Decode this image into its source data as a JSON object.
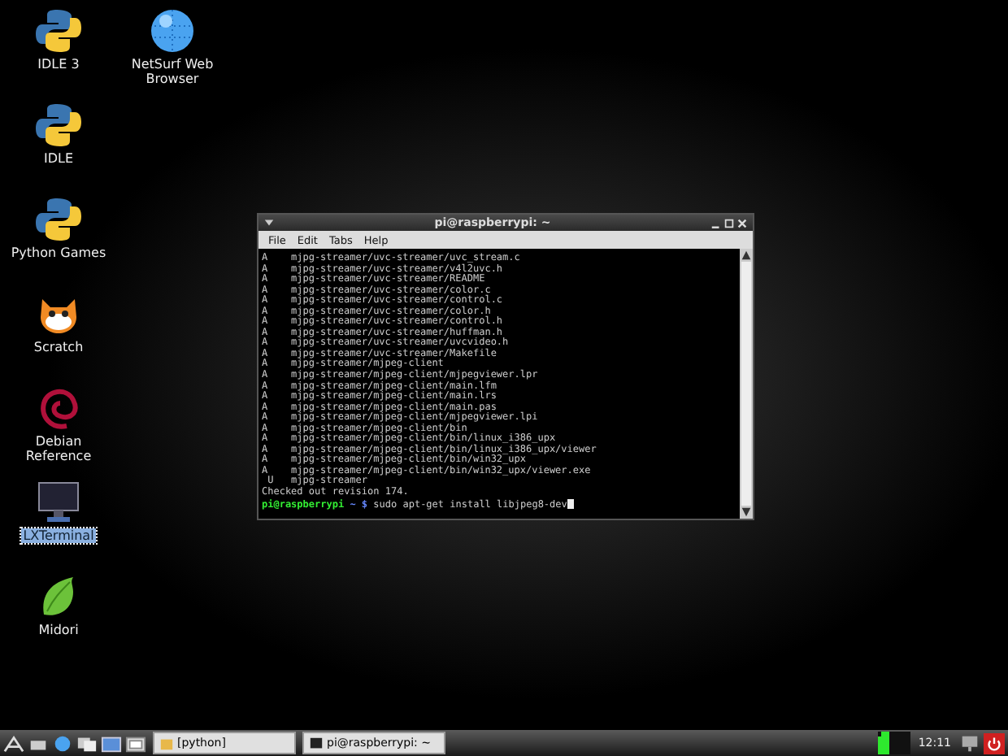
{
  "desktop_icons": [
    {
      "label": "IDLE 3",
      "kind": "python",
      "selected": false
    },
    {
      "label": "NetSurf Web Browser",
      "kind": "globe",
      "selected": false
    },
    {
      "label": "IDLE",
      "kind": "python",
      "selected": false
    },
    {
      "label": "Python Games",
      "kind": "python",
      "selected": false
    },
    {
      "label": "Scratch",
      "kind": "cat",
      "selected": false
    },
    {
      "label": "Debian Reference",
      "kind": "swirl",
      "selected": false
    },
    {
      "label": "LXTerminal",
      "kind": "monitor",
      "selected": true
    },
    {
      "label": "Midori",
      "kind": "leaf",
      "selected": false
    }
  ],
  "terminal": {
    "title": "pi@raspberrypi: ~",
    "menu": [
      "File",
      "Edit",
      "Tabs",
      "Help"
    ],
    "lines": [
      {
        "status": "A",
        "path": "mjpg-streamer/uvc-streamer/uvc_stream.c"
      },
      {
        "status": "A",
        "path": "mjpg-streamer/uvc-streamer/v4l2uvc.h"
      },
      {
        "status": "A",
        "path": "mjpg-streamer/uvc-streamer/README"
      },
      {
        "status": "A",
        "path": "mjpg-streamer/uvc-streamer/color.c"
      },
      {
        "status": "A",
        "path": "mjpg-streamer/uvc-streamer/control.c"
      },
      {
        "status": "A",
        "path": "mjpg-streamer/uvc-streamer/color.h"
      },
      {
        "status": "A",
        "path": "mjpg-streamer/uvc-streamer/control.h"
      },
      {
        "status": "A",
        "path": "mjpg-streamer/uvc-streamer/huffman.h"
      },
      {
        "status": "A",
        "path": "mjpg-streamer/uvc-streamer/uvcvideo.h"
      },
      {
        "status": "A",
        "path": "mjpg-streamer/uvc-streamer/Makefile"
      },
      {
        "status": "A",
        "path": "mjpg-streamer/mjpeg-client"
      },
      {
        "status": "A",
        "path": "mjpg-streamer/mjpeg-client/mjpegviewer.lpr"
      },
      {
        "status": "A",
        "path": "mjpg-streamer/mjpeg-client/main.lfm"
      },
      {
        "status": "A",
        "path": "mjpg-streamer/mjpeg-client/main.lrs"
      },
      {
        "status": "A",
        "path": "mjpg-streamer/mjpeg-client/main.pas"
      },
      {
        "status": "A",
        "path": "mjpg-streamer/mjpeg-client/mjpegviewer.lpi"
      },
      {
        "status": "A",
        "path": "mjpg-streamer/mjpeg-client/bin"
      },
      {
        "status": "A",
        "path": "mjpg-streamer/mjpeg-client/bin/linux_i386_upx"
      },
      {
        "status": "A",
        "path": "mjpg-streamer/mjpeg-client/bin/linux_i386_upx/viewer"
      },
      {
        "status": "A",
        "path": "mjpg-streamer/mjpeg-client/bin/win32_upx"
      },
      {
        "status": "A",
        "path": "mjpg-streamer/mjpeg-client/bin/win32_upx/viewer.exe"
      },
      {
        "status": " U",
        "path": "mjpg-streamer"
      }
    ],
    "message": "Checked out revision 174.",
    "prompt_user": "pi@raspberrypi",
    "prompt_dir": "~ $",
    "command": "sudo apt-get install libjpeg8-dev"
  },
  "taskbar": {
    "tasks": [
      {
        "label": "[python]",
        "kind": "folder"
      },
      {
        "label": "pi@raspberrypi: ~",
        "kind": "terminal"
      }
    ],
    "clock": "12:11"
  }
}
